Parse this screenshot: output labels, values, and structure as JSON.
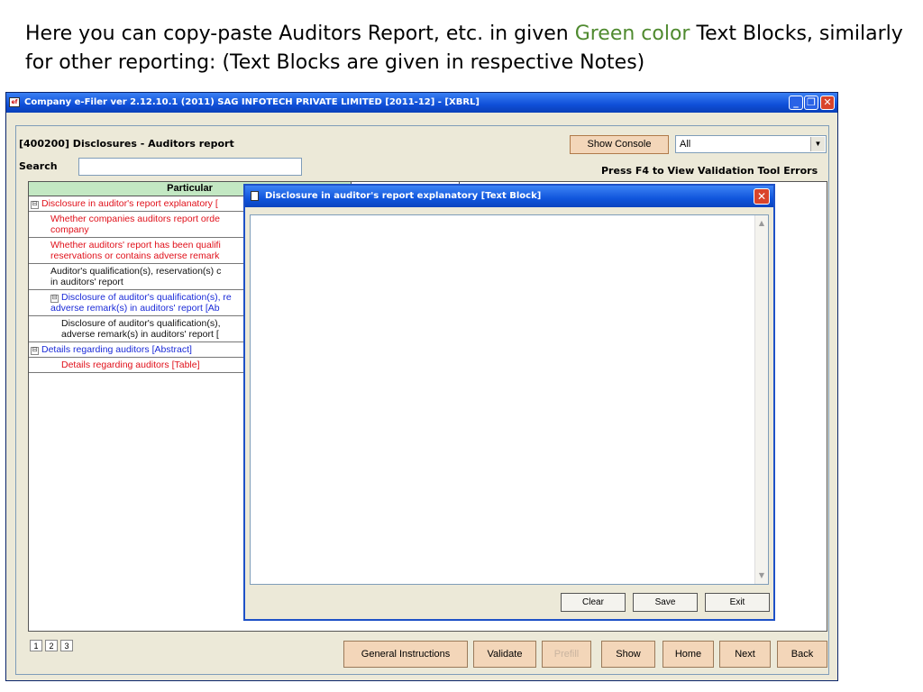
{
  "caption": {
    "part1": "Here you can copy-paste Auditors Report, etc. in given ",
    "green": "Green color",
    "part2": " Text Blocks, similarly for other reporting: (Text Blocks are given in respective Notes)"
  },
  "colors": {
    "caption_green": "#4f8a2f",
    "red_row": "#e0101a",
    "blue_row": "#1a2ad8",
    "header_green": "#c3e8c3",
    "button_peach": "#f3d6b9",
    "titlebar_blue": "#0f4fd8"
  },
  "window": {
    "title": "Company e-Filer ver 2.12.10.1 (2011) SAG INFOTECH PRIVATE LIMITED [2011-12] - [XBRL]",
    "controls": {
      "minimize": "_",
      "restore": "❐",
      "close": "✕"
    }
  },
  "header": {
    "section_title": "[400200] Disclosures - Auditors report",
    "search_label": "Search",
    "search_value": "",
    "show_console": "Show Console",
    "filter_selected": "All",
    "validation_hint": "Press F4 to View Validation Tool Errors"
  },
  "grid": {
    "column_header": "Particular",
    "rows": [
      {
        "text": "Disclosure in auditor's report explanatory [",
        "color": "red",
        "expander": "⊟",
        "indent": 0
      },
      {
        "text": "Whether companies auditors report orde... company",
        "line1": "Whether companies auditors report orde",
        "line2": "company",
        "color": "red",
        "indent": 1
      },
      {
        "line1": "Whether auditors' report has been qualifi",
        "line2": "reservations or contains adverse remark",
        "color": "red",
        "indent": 1
      },
      {
        "line1": "Auditor's qualification(s), reservation(s) c",
        "line2": "in auditors' report",
        "color": "black",
        "indent": 1
      },
      {
        "line1": "Disclosure of auditor's qualification(s), re",
        "line2": "adverse remark(s) in auditors' report [Ab",
        "color": "blue",
        "expander": "⊟",
        "indent": 1
      },
      {
        "line1": "Disclosure of auditor's qualification(s),",
        "line2": "adverse remark(s) in auditors' report [",
        "color": "black",
        "indent": 2
      },
      {
        "text": "Details regarding auditors [Abstract]",
        "color": "blue",
        "expander": "⊟",
        "indent": 0
      },
      {
        "text": "Details regarding auditors [Table]",
        "color": "red",
        "indent": 2
      }
    ]
  },
  "pages": [
    "1",
    "2",
    "3"
  ],
  "footer_buttons": {
    "general_instructions": "General Instructions",
    "validate": "Validate",
    "prefill": "Prefill",
    "show": "Show",
    "home": "Home",
    "next": "Next",
    "back": "Back"
  },
  "dialog": {
    "title": "Disclosure in auditor's report explanatory [Text Block]",
    "text_value": "",
    "clear": "Clear",
    "save": "Save",
    "exit": "Exit"
  }
}
